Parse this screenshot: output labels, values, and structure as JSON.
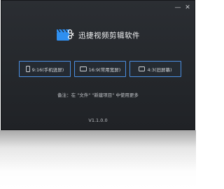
{
  "window": {
    "controls": [
      {
        "name": "minimize",
        "glyph": "—"
      },
      {
        "name": "close",
        "glyph": "✕"
      }
    ]
  },
  "brand": {
    "title": "迅捷视频剪辑软件",
    "logo_icon": "clapperboard-scissors-icon",
    "logo_color": "#2f8ff0"
  },
  "ratios": [
    {
      "label": "9:16(手机竖屏)",
      "icon": "phone-portrait-icon"
    },
    {
      "label": "16:9(常用宽屏)",
      "icon": "widescreen-icon"
    },
    {
      "label": "4:3(旧屏幕)",
      "icon": "standard-screen-icon"
    }
  ],
  "accent_color": "#4b8fe2",
  "note": "备注：在 \"文件\" \"新建项目\" 中使用更多",
  "version": "V1.1.0.0"
}
